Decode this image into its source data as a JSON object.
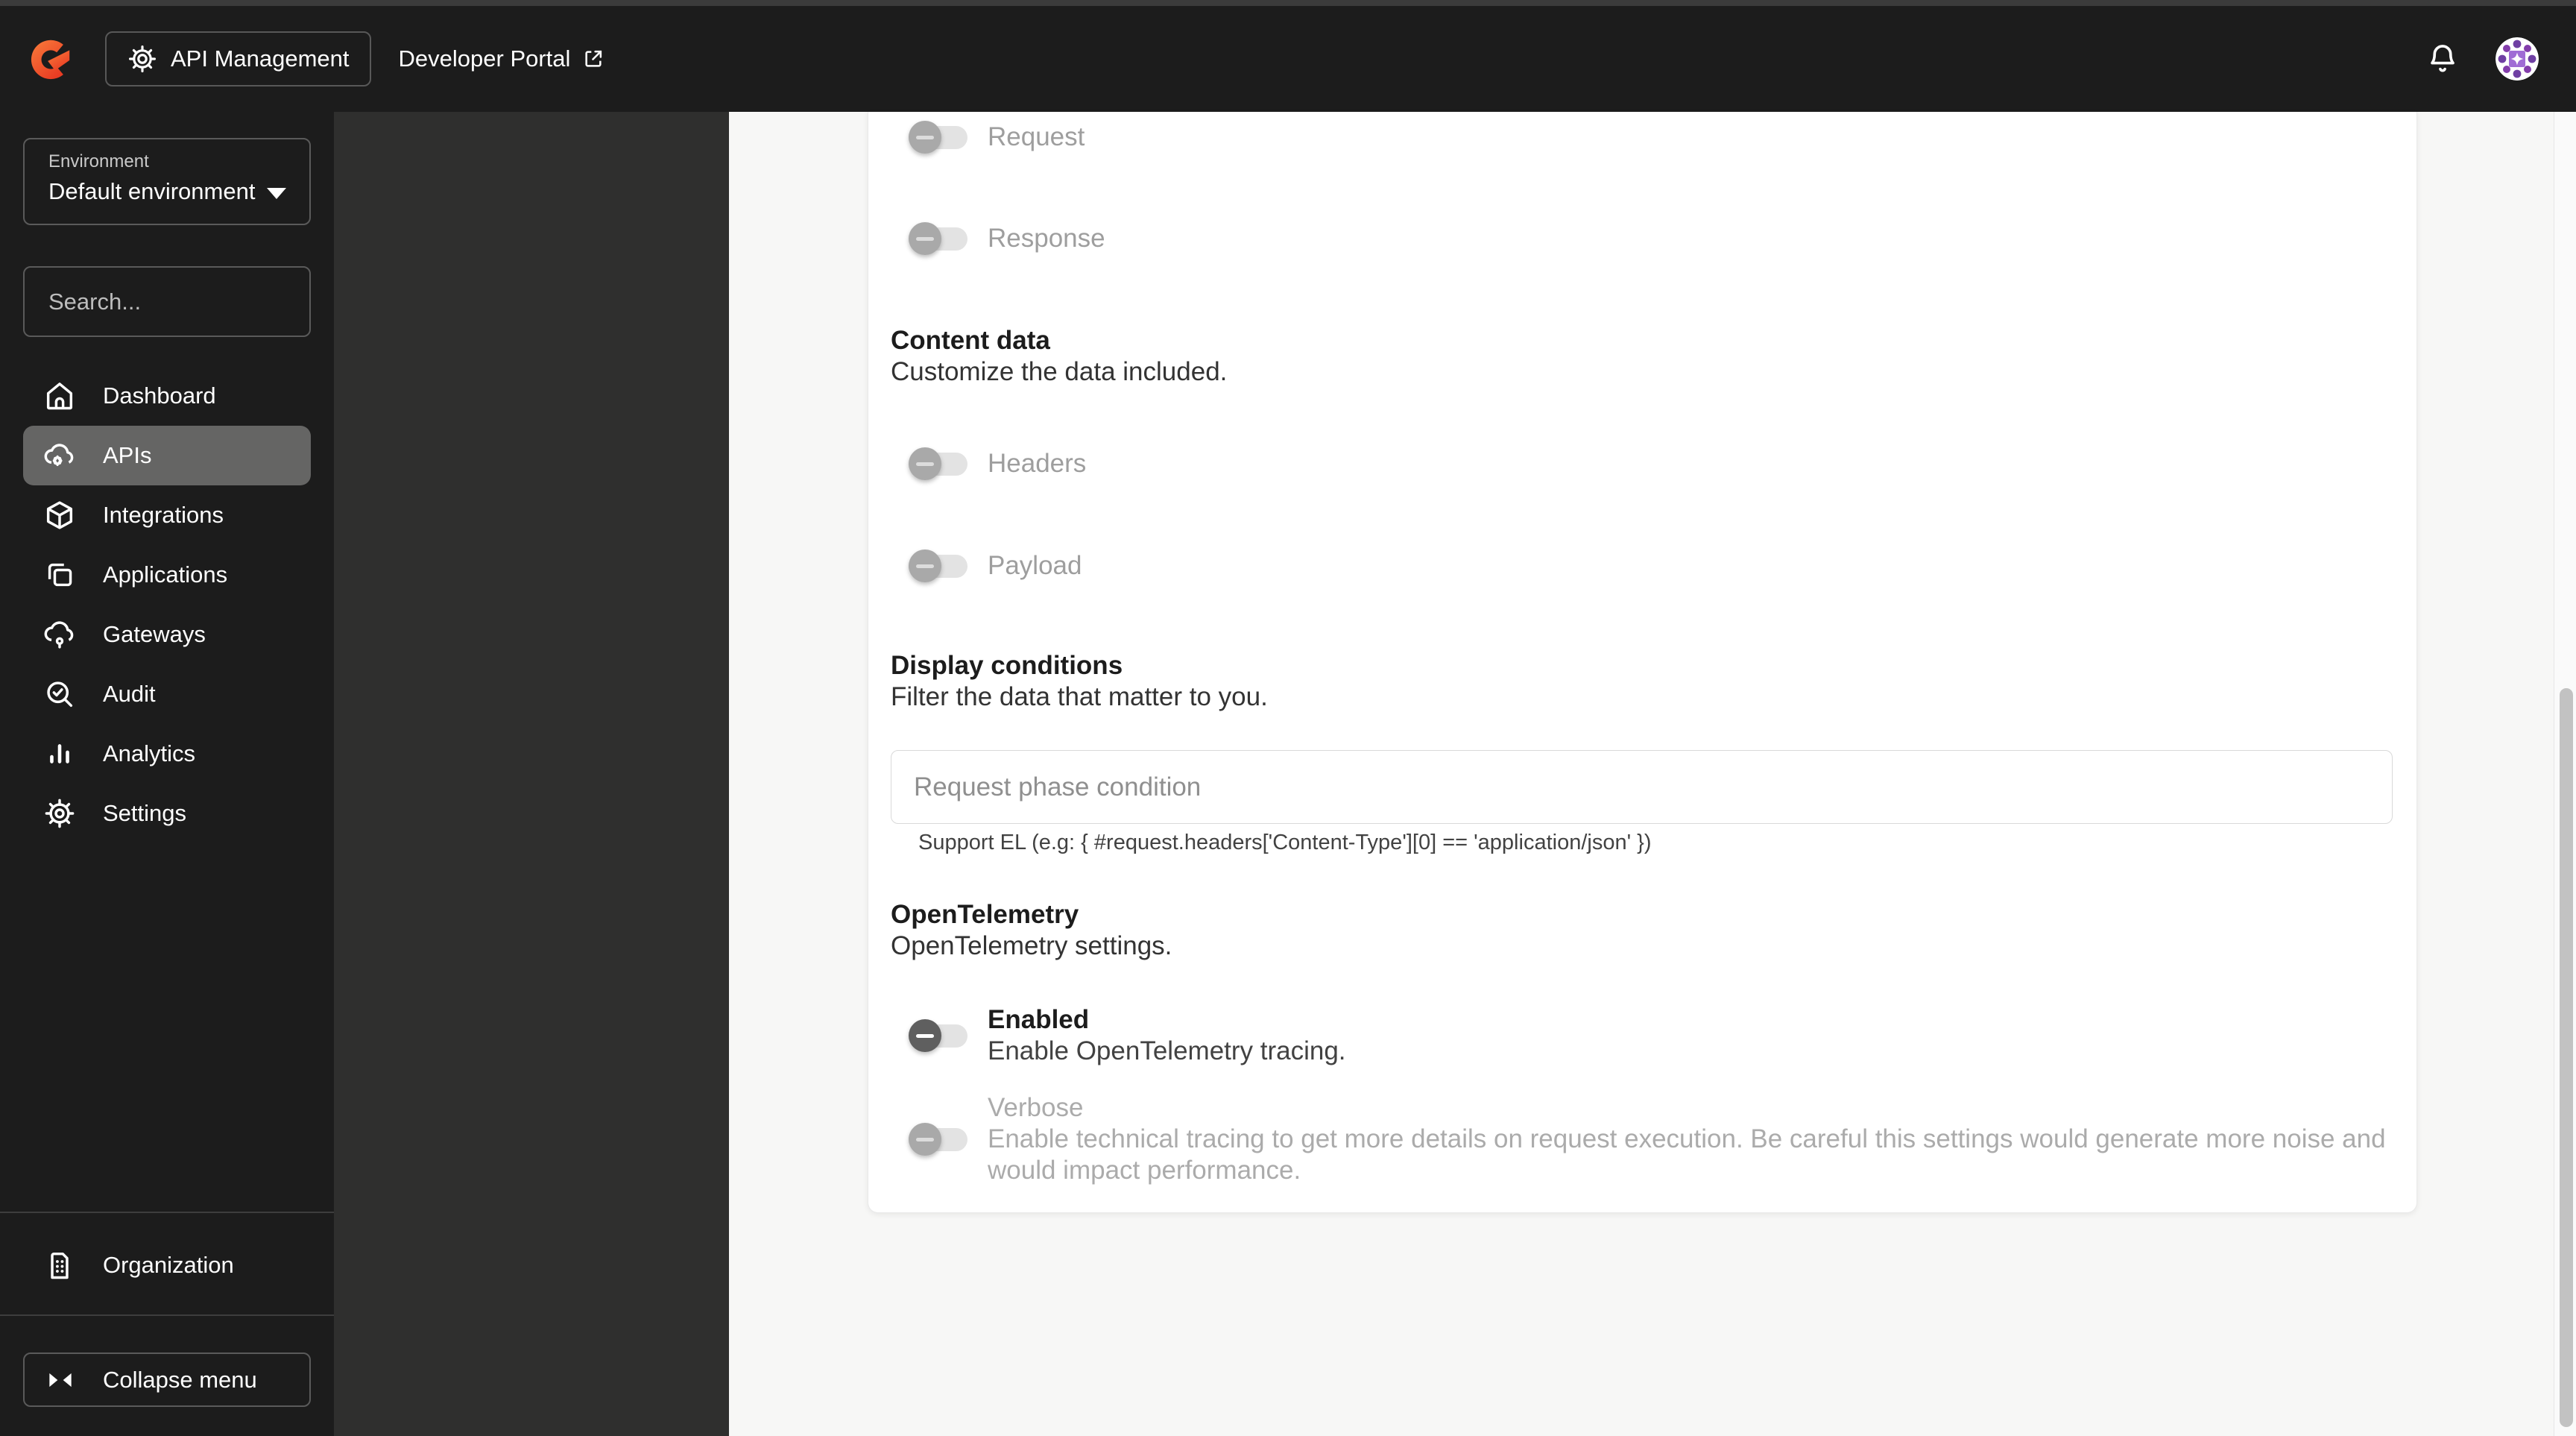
{
  "topbar": {
    "product_label": "API Management",
    "portal_label": "Developer Portal"
  },
  "sidebar": {
    "environment": {
      "label": "Environment",
      "value": "Default environment"
    },
    "search": {
      "placeholder": "Search..."
    },
    "items": [
      {
        "label": "Dashboard",
        "icon": "home-icon",
        "active": false
      },
      {
        "label": "APIs",
        "icon": "cloud-gear-icon",
        "active": true
      },
      {
        "label": "Integrations",
        "icon": "package-icon",
        "active": false
      },
      {
        "label": "Applications",
        "icon": "applications-icon",
        "active": false
      },
      {
        "label": "Gateways",
        "icon": "cloud-gateway-icon",
        "active": false
      },
      {
        "label": "Audit",
        "icon": "audit-icon",
        "active": false
      },
      {
        "label": "Analytics",
        "icon": "analytics-icon",
        "active": false
      },
      {
        "label": "Settings",
        "icon": "gear-icon",
        "active": false
      }
    ],
    "organization_label": "Organization",
    "collapse_label": "Collapse menu"
  },
  "content": {
    "request_toggle_label": "Request",
    "response_toggle_label": "Response",
    "content_data": {
      "title": "Content data",
      "description": "Customize the data included.",
      "headers_toggle_label": "Headers",
      "payload_toggle_label": "Payload"
    },
    "display_conditions": {
      "title": "Display conditions",
      "description": "Filter the data that matter to you.",
      "input_placeholder": "Request phase condition",
      "hint": "Support EL (e.g: { #request.headers['Content-Type'][0] == 'application/json' })"
    },
    "opentelemetry": {
      "title": "OpenTelemetry",
      "description": "OpenTelemetry settings.",
      "enabled": {
        "label": "Enabled",
        "description": "Enable OpenTelemetry tracing."
      },
      "verbose": {
        "label": "Verbose",
        "description": "Enable technical tracing to get more details on request execution. Be careful this settings would generate more noise and would impact performance."
      }
    }
  },
  "colors": {
    "brand_orange_start": "#F97C3B",
    "brand_orange_end": "#E93C23",
    "topbar_bg": "#1c1c1c",
    "subpanel_bg": "#2f2f2e",
    "content_bg": "#f7f7f6",
    "active_item_bg": "#656564",
    "avatar_purple": "#6f3fa3",
    "toggle_thumb_disabled": "#a9a9a9",
    "toggle_thumb_active": "#5f5f5f"
  }
}
